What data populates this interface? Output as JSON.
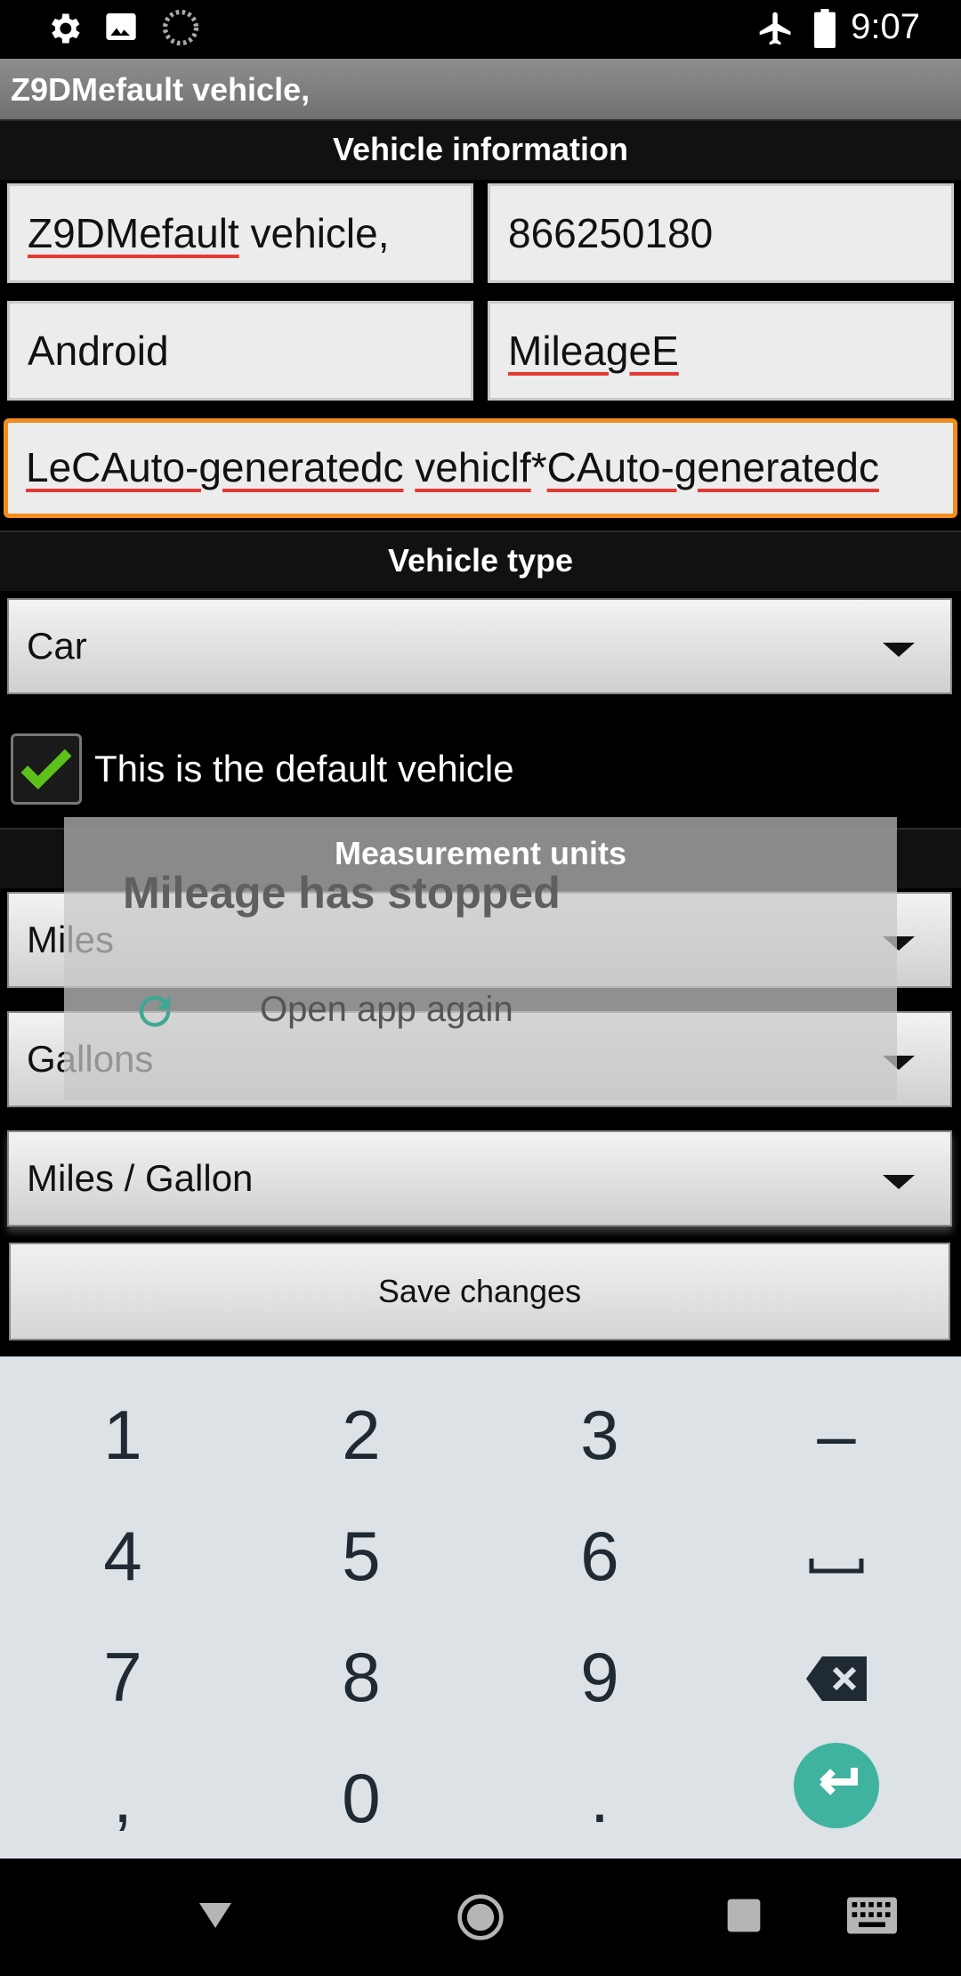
{
  "status_bar": {
    "time": "9:07"
  },
  "app": {
    "title": "Z9DMefault vehicle,"
  },
  "vehicle_info": {
    "header": "Vehicle information",
    "name_value": "Z9DMefault vehicle,",
    "number_value": "866250180",
    "make_value": "Android",
    "model_value": "MileageE",
    "notes_value": "LeCAuto-generatedc vehiclf*CAuto-generatedc"
  },
  "vehicle_type": {
    "header": "Vehicle type",
    "selected": "Car",
    "default_checkbox_label": "This is the default vehicle"
  },
  "measurement_units": {
    "header": "Measurement units",
    "distance": "Miles",
    "volume": "Gallons",
    "economy": "Miles / Gallon"
  },
  "save_button_label": "Save changes",
  "crash_dialog": {
    "title": "Mileage has stopped",
    "action_label": "Open app again"
  },
  "keyboard": {
    "rows": [
      [
        "1",
        "2",
        "3",
        "–"
      ],
      [
        "4",
        "5",
        "6",
        "space"
      ],
      [
        "7",
        "8",
        "9",
        "backspace"
      ],
      [
        ",",
        "0",
        ".",
        "enter"
      ]
    ]
  },
  "colors": {
    "focus_border": "#f28c1c",
    "checkbox_check": "#5cc11b",
    "enter_key": "#3fb39f"
  }
}
